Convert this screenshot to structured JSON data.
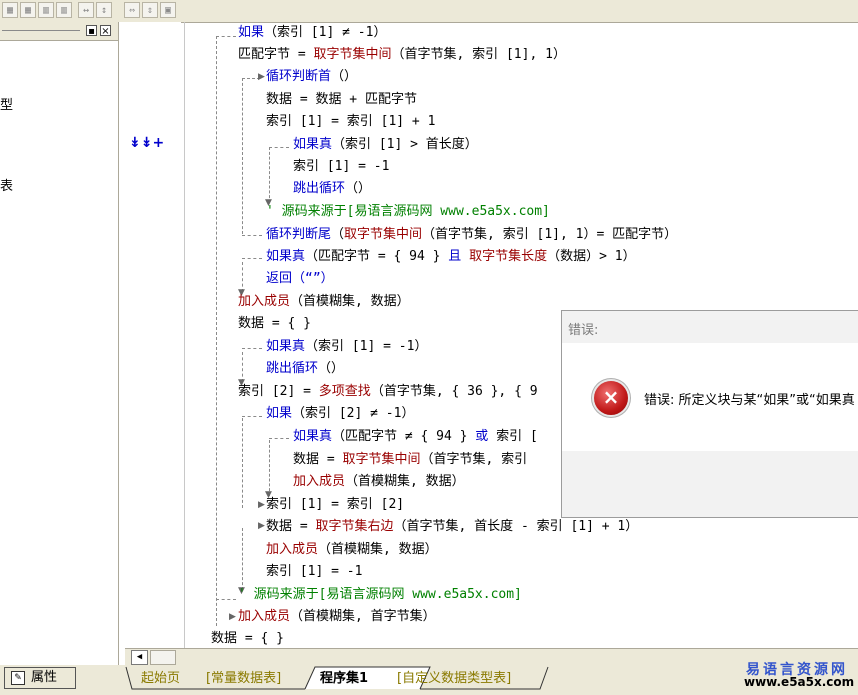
{
  "toolbar": {
    "icons": [
      "align-left-icon",
      "align-center-icon",
      "align-top-icon",
      "align-middle-icon",
      "spread-horizontal-icon",
      "spread-vertical-icon",
      "same-width-icon",
      "same-height-icon",
      "same-size-icon"
    ]
  },
  "left_panel": {
    "min_label": "▪",
    "close_label": "×",
    "fragment_1": "型",
    "fragment_2": "表"
  },
  "gutter": {
    "marker": "↡↡+"
  },
  "code": {
    "l1_kw": "如果",
    "l1_rest": "（索引 [1] ≠ -1）",
    "l2_a": "匹配字节 = ",
    "l2_fn": "取字节集中间",
    "l2_b": "（首字节集, 索引 [1], 1）",
    "l3_kw": "循环判断首",
    "l3_b": "（）",
    "l4": "数据 = 数据 + 匹配字节",
    "l5": "索引 [1] = 索引 [1] + 1",
    "l6_kw": "如果真",
    "l6_b": "（索引 [1] > 首长度）",
    "l7": "索引 [1] = -1",
    "l8_kw": "跳出循环",
    "l8_b": "（）",
    "l9": "' 源码来源于[易语言源码网 www.e5a5x.com]",
    "l10_kw": "循环判断尾",
    "l10_b": "（",
    "l10_fn": "取字节集中间",
    "l10_c": "（首字节集, 索引 [1], 1）= 匹配字节）",
    "l11_kw": "如果真",
    "l11_b": "（匹配字节 = { 94 } ",
    "l11_kw2": "且",
    "l11_fn": " 取字节集长度",
    "l11_c": "（数据）> 1）",
    "l12_kw": "返回",
    "l12_b": "（“”）",
    "l13_fn": "加入成员",
    "l13_b": "（首模糊集, 数据）",
    "l14": "数据 = { }",
    "l15_kw": "如果真",
    "l15_b": "（索引 [1] = -1）",
    "l16_kw": "跳出循环",
    "l16_b": "（）",
    "l17_a": "索引 [2] = ",
    "l17_fn": "多项查找",
    "l17_b": "（首字节集, { 36 }, { 9",
    "l18_kw": "如果",
    "l18_b": "（索引 [2] ≠ -1）",
    "l19_kw": "如果真",
    "l19_b": "（匹配字节 ≠ { 94 } ",
    "l19_kw2": "或",
    "l19_c": " 索引 [",
    "l20_a": "数据 = ",
    "l20_fn": "取字节集中间",
    "l20_b": "（首字节集, 索引",
    "l21_fn": "加入成员",
    "l21_b": "（首模糊集, 数据）",
    "l22": "索引 [1] = 索引 [2]",
    "l23_a": "数据 = ",
    "l23_fn": "取字节集右边",
    "l23_b": "（首字节集, 首长度 - 索引 [1] + 1）",
    "l24_fn": "加入成员",
    "l24_b": "（首模糊集, 数据）",
    "l25": "索引 [1] = -1",
    "l26": "' 源码来源于[易语言源码网 www.e5a5x.com]",
    "l27_fn": "加入成员",
    "l27_b": "（首模糊集, 首字节集）",
    "l28": "数据 = { }"
  },
  "dialog": {
    "title": "错误:",
    "icon": "×",
    "message": "错误: 所定义块与某“如果”或“如果真"
  },
  "scrollbar": {
    "left_arrow": "◀"
  },
  "tabbar": {
    "attr_label": "属性",
    "tabs": [
      "起始页",
      "[常量数据表]",
      "程序集1",
      "[自定义数据类型表]"
    ],
    "active_tab": "程序集1"
  },
  "watermark": {
    "line1": "易语言资源网",
    "line2": "www.e5a5x.com"
  },
  "colors": {
    "keyword": "#0000cc",
    "function": "#990000",
    "comment": "#008000",
    "tab_text": "#8a7a00",
    "watermark_blue": "#3355cc"
  }
}
